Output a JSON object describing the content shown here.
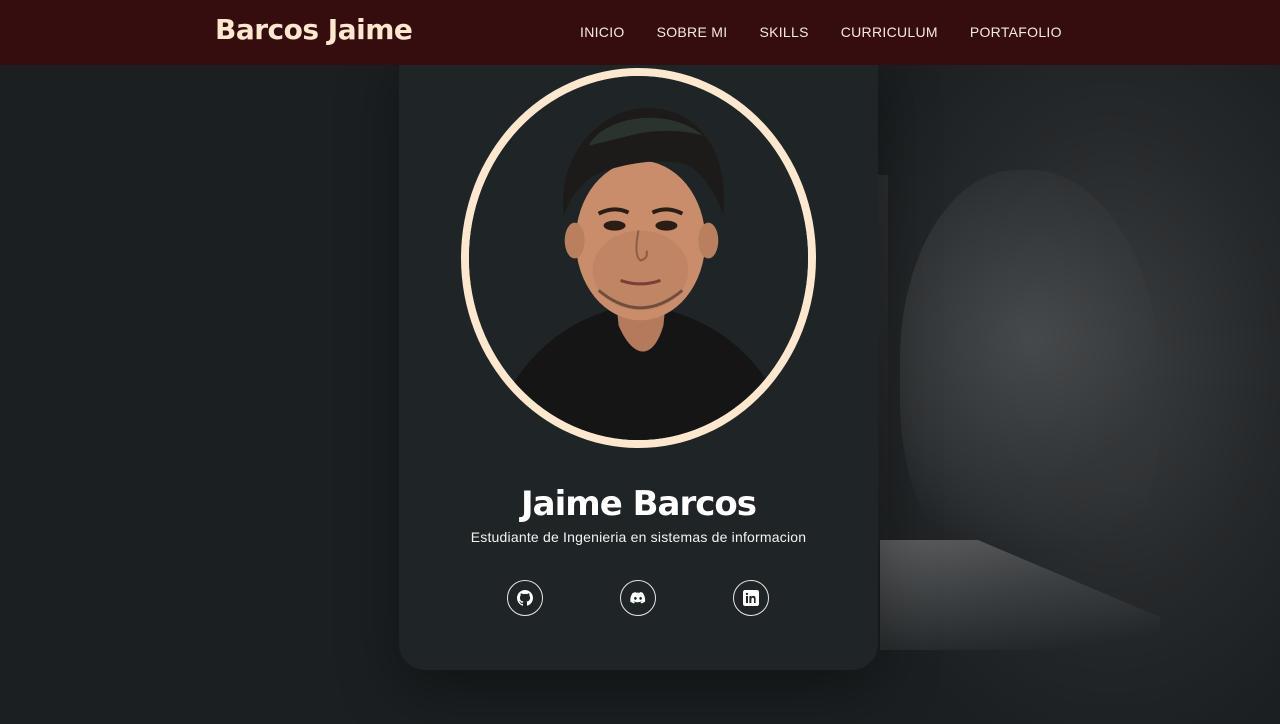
{
  "header": {
    "brand": "Barcos Jaime",
    "nav": [
      "INICIO",
      "SOBRE MI",
      "SKILLS",
      "CURRICULUM",
      "PORTAFOLIO"
    ]
  },
  "profile": {
    "name": "Jaime Barcos",
    "subtitle": "Estudiante de Ingenieria en sistemas de informacion"
  },
  "social": {
    "icons": [
      "github-icon",
      "discord-icon",
      "linkedin-icon"
    ]
  },
  "colors": {
    "header_bg": "#360d0f",
    "accent": "#fde7cf",
    "page_bg": "#1b1f21",
    "card_bg": "#1f2426"
  }
}
